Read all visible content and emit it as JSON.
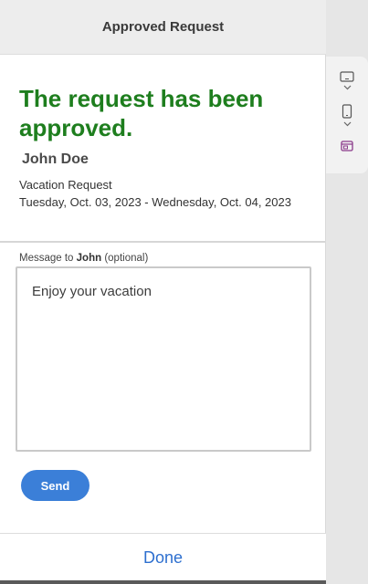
{
  "header": {
    "title": "Approved Request"
  },
  "status": {
    "headline": "The request has been approved."
  },
  "request": {
    "employee_name": "John Doe",
    "type": "Vacation Request",
    "dates": "Tuesday, Oct. 03, 2023 - Wednesday, Oct. 04, 2023"
  },
  "message": {
    "label_prefix": "Message to ",
    "label_name": "John",
    "label_suffix": " (optional)",
    "value": "Enjoy your vacation"
  },
  "actions": {
    "send_label": "Send",
    "done_label": "Done"
  },
  "side_panel": {
    "items": [
      {
        "icon": "tablet-landscape-icon"
      },
      {
        "icon": "phone-portrait-icon"
      },
      {
        "icon": "card-preview-icon"
      }
    ]
  },
  "colors": {
    "headline": "#1e7e1e",
    "primary": "#3b7fd8",
    "done_link": "#2d6fcf",
    "accent_icon": "#8a3a8a"
  }
}
